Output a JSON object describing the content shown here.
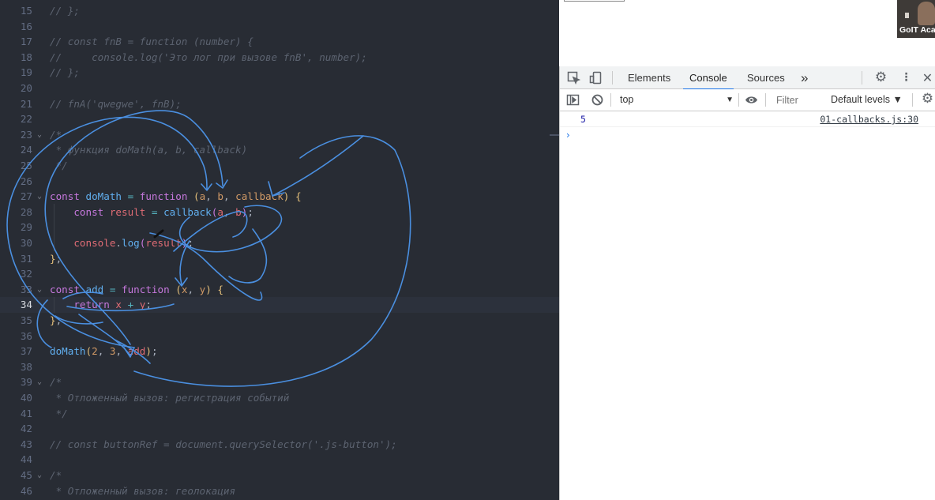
{
  "editor": {
    "lines": [
      {
        "n": "15",
        "fold": "",
        "segs": [
          {
            "c": "cm",
            "t": "// };"
          }
        ]
      },
      {
        "n": "16",
        "fold": "",
        "segs": []
      },
      {
        "n": "17",
        "fold": "",
        "segs": [
          {
            "c": "cm",
            "t": "// const fnB = function (number) {"
          }
        ]
      },
      {
        "n": "18",
        "fold": "",
        "segs": [
          {
            "c": "cm",
            "t": "//     console.log('Это лог при вызове fnB', number);"
          }
        ]
      },
      {
        "n": "19",
        "fold": "",
        "segs": [
          {
            "c": "cm",
            "t": "// };"
          }
        ]
      },
      {
        "n": "20",
        "fold": "",
        "segs": []
      },
      {
        "n": "21",
        "fold": "",
        "segs": [
          {
            "c": "cm",
            "t": "// fnA('qwegwe', fnB);"
          }
        ]
      },
      {
        "n": "22",
        "fold": "",
        "segs": []
      },
      {
        "n": "23",
        "fold": "⌄",
        "segs": [
          {
            "c": "cm",
            "t": "/*"
          }
        ]
      },
      {
        "n": "24",
        "fold": "",
        "segs": [
          {
            "c": "cm",
            "t": " * функция doMath(a, b, callback)"
          }
        ]
      },
      {
        "n": "25",
        "fold": "",
        "segs": [
          {
            "c": "cm",
            "t": " */"
          }
        ]
      },
      {
        "n": "26",
        "fold": "",
        "segs": []
      },
      {
        "n": "27",
        "fold": "⌄",
        "segs": [
          {
            "c": "kw",
            "t": "const "
          },
          {
            "c": "fn",
            "t": "doMath"
          },
          {
            "c": "op",
            "t": " = "
          },
          {
            "c": "kw",
            "t": "function "
          },
          {
            "c": "pn",
            "t": "("
          },
          {
            "c": "nm",
            "t": "a"
          },
          {
            "c": "tx",
            "t": ", "
          },
          {
            "c": "nm",
            "t": "b"
          },
          {
            "c": "tx",
            "t": ", "
          },
          {
            "c": "nm",
            "t": "callback"
          },
          {
            "c": "pn",
            "t": ") {"
          }
        ]
      },
      {
        "n": "28",
        "fold": "",
        "segs": [
          {
            "c": "tx",
            "t": "    "
          },
          {
            "c": "kw",
            "t": "const "
          },
          {
            "c": "vr",
            "t": "result"
          },
          {
            "c": "op",
            "t": " = "
          },
          {
            "c": "fn",
            "t": "callback"
          },
          {
            "c": "kw",
            "t": "("
          },
          {
            "c": "vr",
            "t": "a"
          },
          {
            "c": "tx",
            "t": ", "
          },
          {
            "c": "vr",
            "t": "b"
          },
          {
            "c": "kw",
            "t": ")"
          },
          {
            "c": "tx",
            "t": ";"
          }
        ]
      },
      {
        "n": "29",
        "fold": "",
        "segs": []
      },
      {
        "n": "30",
        "fold": "",
        "segs": [
          {
            "c": "tx",
            "t": "    "
          },
          {
            "c": "vr",
            "t": "console"
          },
          {
            "c": "tx",
            "t": "."
          },
          {
            "c": "fn",
            "t": "log"
          },
          {
            "c": "kw",
            "t": "("
          },
          {
            "c": "vr",
            "t": "result"
          },
          {
            "c": "kw",
            "t": ")"
          },
          {
            "c": "tx",
            "t": ";"
          }
        ]
      },
      {
        "n": "31",
        "fold": "",
        "segs": [
          {
            "c": "pn",
            "t": "}"
          },
          {
            "c": "tx",
            "t": ";"
          }
        ]
      },
      {
        "n": "32",
        "fold": "",
        "segs": []
      },
      {
        "n": "33",
        "fold": "⌄",
        "segs": [
          {
            "c": "kw",
            "t": "const "
          },
          {
            "c": "fn",
            "t": "add"
          },
          {
            "c": "op",
            "t": " = "
          },
          {
            "c": "kw",
            "t": "function "
          },
          {
            "c": "pn",
            "t": "("
          },
          {
            "c": "nm",
            "t": "x"
          },
          {
            "c": "tx",
            "t": ", "
          },
          {
            "c": "nm",
            "t": "y"
          },
          {
            "c": "pn",
            "t": ") {"
          }
        ]
      },
      {
        "n": "34",
        "fold": "",
        "segs": [
          {
            "c": "tx",
            "t": "    "
          },
          {
            "c": "kw",
            "t": "return "
          },
          {
            "c": "vr",
            "t": "x"
          },
          {
            "c": "op",
            "t": " + "
          },
          {
            "c": "vr",
            "t": "y"
          },
          {
            "c": "tx",
            "t": ";"
          }
        ]
      },
      {
        "n": "35",
        "fold": "",
        "segs": [
          {
            "c": "pn",
            "t": "}"
          },
          {
            "c": "tx",
            "t": ";"
          }
        ]
      },
      {
        "n": "36",
        "fold": "",
        "segs": []
      },
      {
        "n": "37",
        "fold": "",
        "segs": [
          {
            "c": "fn",
            "t": "doMath"
          },
          {
            "c": "pn",
            "t": "("
          },
          {
            "c": "nm",
            "t": "2"
          },
          {
            "c": "tx",
            "t": ", "
          },
          {
            "c": "nm",
            "t": "3"
          },
          {
            "c": "tx",
            "t": ", "
          },
          {
            "c": "vr",
            "t": "add"
          },
          {
            "c": "pn",
            "t": ")"
          },
          {
            "c": "tx",
            "t": ";"
          }
        ]
      },
      {
        "n": "38",
        "fold": "",
        "segs": []
      },
      {
        "n": "39",
        "fold": "⌄",
        "segs": [
          {
            "c": "cm",
            "t": "/*"
          }
        ]
      },
      {
        "n": "40",
        "fold": "",
        "segs": [
          {
            "c": "cm",
            "t": " * Отложенный вызов: регистрация событий"
          }
        ]
      },
      {
        "n": "41",
        "fold": "",
        "segs": [
          {
            "c": "cm",
            "t": " */"
          }
        ]
      },
      {
        "n": "42",
        "fold": "",
        "segs": []
      },
      {
        "n": "43",
        "fold": "",
        "segs": [
          {
            "c": "cm",
            "t": "// const buttonRef = document.querySelector('.js-button');"
          }
        ]
      },
      {
        "n": "44",
        "fold": "",
        "segs": []
      },
      {
        "n": "45",
        "fold": "⌄",
        "segs": [
          {
            "c": "cm",
            "t": "/*"
          }
        ]
      },
      {
        "n": "46",
        "fold": "",
        "segs": [
          {
            "c": "cm",
            "t": " * Отложенный вызов: геолокация"
          }
        ]
      }
    ],
    "current_line": "34",
    "annotation_color": "#4a8fe0"
  },
  "video": {
    "label": "GoIT Aca"
  },
  "devtools": {
    "tabs": [
      {
        "label": "Elements",
        "active": false
      },
      {
        "label": "Console",
        "active": true
      },
      {
        "label": "Sources",
        "active": false
      }
    ],
    "more_tabs_glyph": "»",
    "icons": {
      "inspect": "inspect-icon",
      "device": "device-toolbar-icon",
      "settings": "gear-icon",
      "menu": "kebab-menu-icon",
      "close": "close-icon",
      "sidebar": "sidebar-toggle-icon",
      "clear": "clear-console-icon",
      "eye": "eye-icon"
    },
    "context": "top",
    "filter_placeholder": "Filter",
    "levels": "Default levels ▼",
    "messages": [
      {
        "value": "5",
        "source": "01-callbacks.js:30"
      }
    ],
    "prompt_glyph": "›"
  }
}
